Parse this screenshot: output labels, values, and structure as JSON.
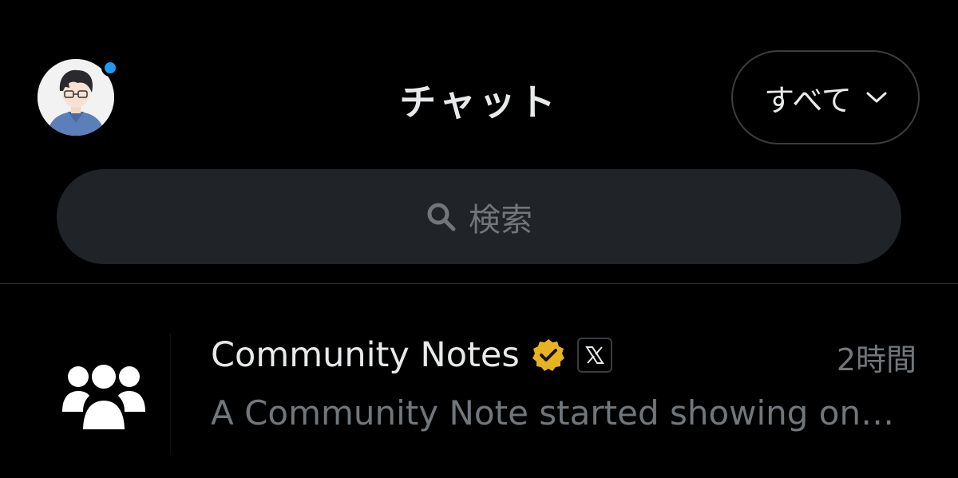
{
  "header": {
    "title": "チャット",
    "filter_label": "すべて",
    "has_notification": true,
    "notification_color": "#1d9bf0"
  },
  "search": {
    "placeholder": "検索"
  },
  "conversations": [
    {
      "name": "Community Notes",
      "verified": true,
      "verified_color": "#e6b422",
      "affiliate_badge": "x-logo-icon",
      "time": "2時間",
      "preview": "A Community Note started showing on…",
      "avatar_icon": "people-group-icon"
    }
  ],
  "colors": {
    "background": "#000000",
    "search_bg": "#202327",
    "secondary_text": "#71767b",
    "primary_text": "#e7e9ea"
  }
}
